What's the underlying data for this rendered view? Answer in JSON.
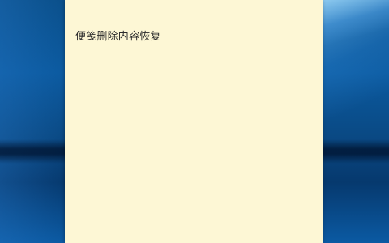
{
  "note": {
    "text": "便笺删除内容恢复",
    "background_color": "#fdf7d5"
  },
  "desktop": {
    "wallpaper": "windows-10-blue"
  }
}
